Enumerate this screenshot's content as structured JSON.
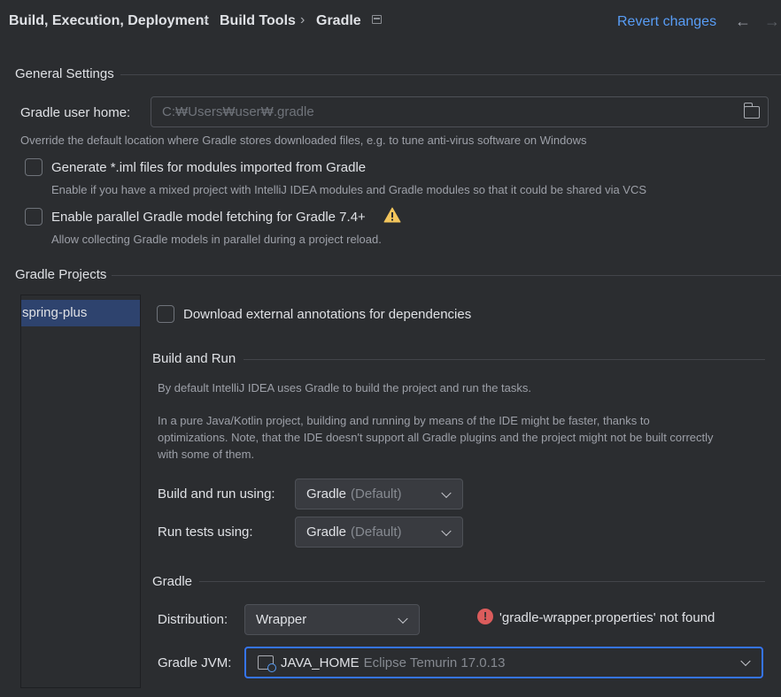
{
  "header": {
    "breadcrumb": [
      "Build, Execution, Deployment",
      "Build Tools",
      "Gradle"
    ],
    "separator": "›",
    "revert_label": "Revert changes",
    "back_arrow": "←",
    "forward_arrow": "→",
    "icons": {
      "pin": "pin-tab-icon",
      "back": "arrow-left-icon",
      "forward": "arrow-right-icon"
    }
  },
  "general": {
    "title": "General Settings",
    "gradle_home_label": "Gradle user home:",
    "gradle_home_placeholder": "C:₩Users₩user₩.gradle",
    "gradle_home_hint": "Override the default location where Gradle stores downloaded files, e.g. to tune anti-virus software on Windows",
    "iml": {
      "label": "Generate *.iml files for modules imported from Gradle",
      "hint": "Enable if you have a mixed project with IntelliJ IDEA modules and Gradle modules so that it could be shared via VCS",
      "checked": false
    },
    "parallel": {
      "label": "Enable parallel Gradle model fetching for Gradle 7.4+",
      "hint": "Allow collecting Gradle models in parallel during a project reload.",
      "checked": false,
      "warning_icon": "warning-icon"
    }
  },
  "projects": {
    "title": "Gradle Projects",
    "items": [
      "spring-plus"
    ],
    "selected": "spring-plus"
  },
  "project_settings": {
    "download_annotations": {
      "label": "Download external annotations for dependencies",
      "checked": false
    },
    "build_and_run": {
      "title": "Build and Run",
      "description_1": "By default IntelliJ IDEA uses Gradle to build the project and run the tasks.",
      "description_2_line1": "In a pure Java/Kotlin project, building and running by means of the IDE might be faster, thanks to",
      "description_2_line2": "optimizations. Note, that the IDE doesn't support all Gradle plugins and the project might not be built correctly",
      "description_2_line3": "with some of them.",
      "build_run_using": {
        "label": "Build and run using:",
        "value": "Gradle",
        "suffix": "(Default)"
      },
      "run_tests_using": {
        "label": "Run tests using:",
        "value": "Gradle",
        "suffix": "(Default)"
      }
    },
    "gradle": {
      "title": "Gradle",
      "distribution": {
        "label": "Distribution:",
        "value": "Wrapper"
      },
      "error_text": "'gradle-wrapper.properties' not found",
      "error_glyph": "!",
      "jvm": {
        "label": "Gradle JVM:",
        "value": "JAVA_HOME",
        "detail": "Eclipse Temurin 17.0.13"
      }
    }
  },
  "colors": {
    "background": "#2b2d30",
    "link": "#589df6",
    "selection": "#2e436e",
    "focus": "#3574f0",
    "error": "#db5c5c",
    "warning": "#f2c55c"
  }
}
